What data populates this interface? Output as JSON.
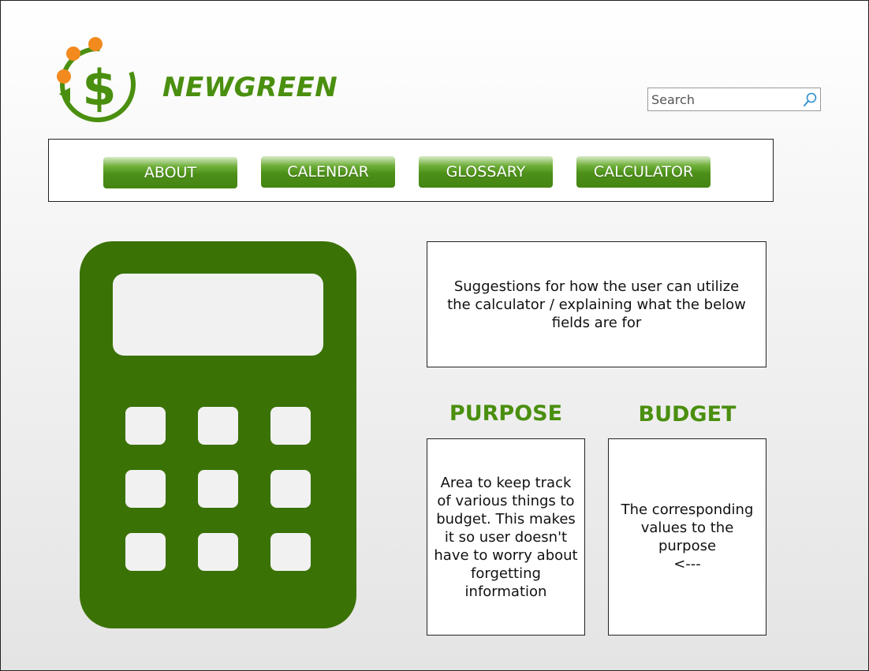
{
  "header": {
    "brand": "NEWGREEN",
    "logo_icon": "dollar-cycle-logo-icon",
    "search": {
      "placeholder": "Search",
      "value": "",
      "icon": "search-icon"
    }
  },
  "nav": {
    "items": [
      {
        "label": "ABOUT"
      },
      {
        "label": "CALENDAR"
      },
      {
        "label": "GLOSSARY"
      },
      {
        "label": "CALCULATOR"
      }
    ]
  },
  "main": {
    "calculator_icon": "calculator-icon",
    "suggestions_text": "Suggestions for how the user can utilize the calculator / explaining what the below fields are for",
    "purpose": {
      "heading": "PURPOSE",
      "text": "Area to keep track of various things to budget. This makes it so user doesn't have to worry about forgetting information"
    },
    "budget": {
      "heading": "BUDGET",
      "text": "The corresponding values to the purpose\n<---"
    }
  },
  "colors": {
    "brand_green": "#4a8f0f",
    "calculator_green": "#3a7205",
    "accent_orange": "#f28a1e",
    "button_green": "#4c8f18"
  }
}
